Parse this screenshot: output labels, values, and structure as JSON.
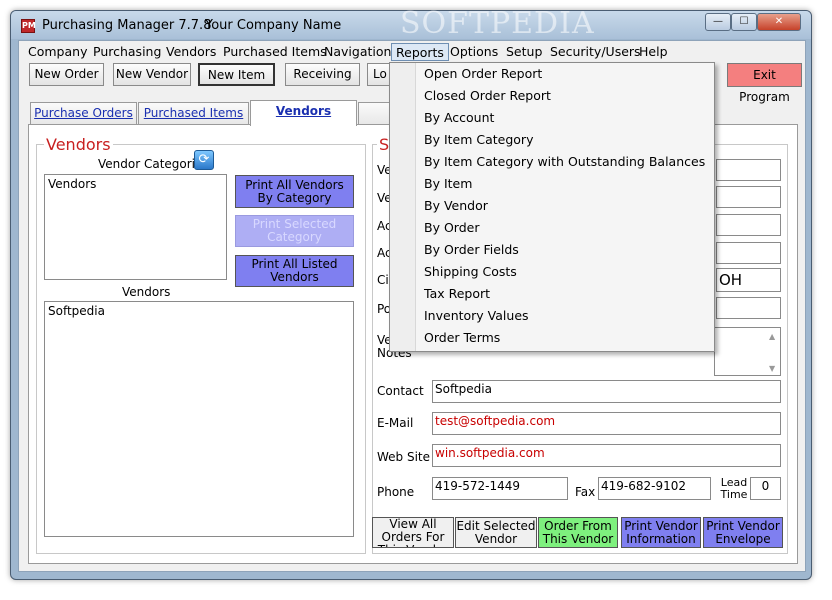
{
  "window": {
    "app_title": "Purchasing Manager 7.7.8",
    "company_name": "Your Company Name",
    "watermark": "SOFTPEDIA",
    "app_icon_text": "PM",
    "minimize": "—",
    "maximize": "☐",
    "close": "✕"
  },
  "menubar": [
    "Company",
    "Purchasing",
    "Vendors",
    "Purchased Items",
    "Navigation",
    "Reports",
    "Options",
    "Setup",
    "Security/Users",
    "Help"
  ],
  "toolbar": {
    "new_order": "New Order",
    "new_vendor": "New Vendor",
    "new_item": "New Item",
    "receiving": "Receiving",
    "partial": "Lo",
    "exit": "Exit Program"
  },
  "tabs": [
    "Purchase Orders",
    "Purchased Items",
    "Vendors"
  ],
  "vendors_panel": {
    "legend": "Vendors",
    "categories_label": "Vendor Categories",
    "categories": [
      "Vendors"
    ],
    "print_all_by_category": "Print All Vendors By Category",
    "print_selected_category": "Print Selected Category",
    "print_all_listed": "Print All Listed Vendors",
    "vendors_label": "Vendors",
    "vendors": [
      "Softpedia"
    ]
  },
  "details_panel": {
    "legend": "S",
    "partial_labels": [
      "Ve",
      "Ve",
      "Ac",
      "Ac",
      "Cit",
      "Po",
      "Ve"
    ],
    "notes_label": "Notes",
    "state_value": "OH",
    "contact_label": "Contact",
    "contact_value": "Softpedia",
    "email_label": "E-Mail",
    "email_value": "test@softpedia.com",
    "website_label": "Web Site",
    "website_value": "win.softpedia.com",
    "phone_label": "Phone",
    "phone_value": "419-572-1449",
    "fax_label": "Fax",
    "fax_value": "419-682-9102",
    "lead_time_label": "Lead Time",
    "lead_time_value": "0"
  },
  "bottom_buttons": {
    "view_all_orders": "View All Orders For This Vendor",
    "edit_selected": "Edit Selected Vendor",
    "order_from": "Order From This Vendor",
    "print_info": "Print Vendor Information",
    "print_envelope": "Print Vendor Envelope"
  },
  "reports_menu": [
    "Open Order Report",
    "Closed Order Report",
    "By Account",
    "By Item Category",
    "By Item Category with Outstanding Balances",
    "By Item",
    "By Vendor",
    "By Order",
    "By Order Fields",
    "Shipping Costs",
    "Tax Report",
    "Inventory Values",
    "Order Terms"
  ],
  "colors": {
    "accent_red": "#c82020",
    "purple_button": "#7f7ff0",
    "green_button": "#7ef07e",
    "exit_button": "#f47f7f"
  }
}
